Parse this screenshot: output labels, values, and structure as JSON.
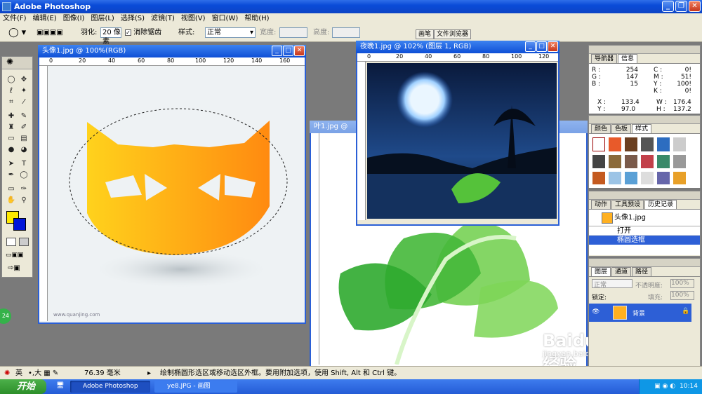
{
  "app": {
    "title": "Adobe Photoshop"
  },
  "menu": [
    "文件(F)",
    "编辑(E)",
    "图像(I)",
    "图层(L)",
    "选择(S)",
    "滤镜(T)",
    "视图(V)",
    "窗口(W)",
    "帮助(H)"
  ],
  "options": {
    "feather_label": "羽化:",
    "feather_value": "20 像素",
    "antialias_label": "消除锯齿",
    "style_label": "样式:",
    "style_value": "正常",
    "width_label": "宽度:",
    "height_label": "高度:",
    "tab_brush": "画笔",
    "tab_browser": "文件浏览器"
  },
  "windows": {
    "doc1_title": "头像1.jpg @ 100%(RGB)",
    "doc2_title": "夜晚1.jpg @ 102% (图层 1, RGB)",
    "doc3_title": "叶1.jpg @ ",
    "watermark": "www.quanjing.com"
  },
  "rulers": {
    "doc1_ticks": [
      "0",
      "20",
      "40",
      "60",
      "80",
      "100",
      "120",
      "140",
      "160"
    ],
    "doc2_ticks": [
      "0",
      "20",
      "40",
      "60",
      "80",
      "100",
      "120"
    ]
  },
  "info_panel": {
    "tabs": [
      "导航器",
      "信息"
    ],
    "r": "254",
    "g": "147",
    "b": "15",
    "c": "0!",
    "m": "51!",
    "y": "100!",
    "k": "0!",
    "x": "133.4",
    "yv": "97.0",
    "w": "176.4",
    "h": "137.2",
    "r_label": "R :",
    "g_label": "G :",
    "b_label": "B :",
    "c_label": "C :",
    "m_label": "M :",
    "y_label": "Y :",
    "k_label": "K :",
    "x_label": "X :",
    "yv_label": "Y :",
    "w_label": "W :",
    "h_label": "H :"
  },
  "color_panel": {
    "tabs": [
      "颜色",
      "色板",
      "样式"
    ]
  },
  "history_panel": {
    "tabs": [
      "动作",
      "工具预设",
      "历史记录"
    ],
    "snapshot": "头像1.jpg",
    "steps": [
      "打开",
      "椭圆选框"
    ]
  },
  "layers_panel": {
    "tabs": [
      "图层",
      "通道",
      "路径"
    ],
    "mode": "正常",
    "opacity_label": "不透明度:",
    "opacity": "100%",
    "lock_label": "锁定:",
    "fill_label": "填充:",
    "fill": "100%",
    "layer_name": "背景"
  },
  "status": {
    "ime": "英",
    "size": "76.39 毫米",
    "hint": "绘制椭圆形选区或移动选区外框。要用附加选项，使用 Shift, Alt 和 Ctrl 键。"
  },
  "taskbar": {
    "start": "开始",
    "task1": "Adobe Photoshop",
    "task2": "ye8.JPG - 画图",
    "time": "10:14"
  },
  "colors": {
    "foreground": "#ffea00",
    "background": "#0015d8"
  },
  "overlay": {
    "badge": "24",
    "baidu": "Baidu经验",
    "url": "jingyan.baidu.com"
  }
}
